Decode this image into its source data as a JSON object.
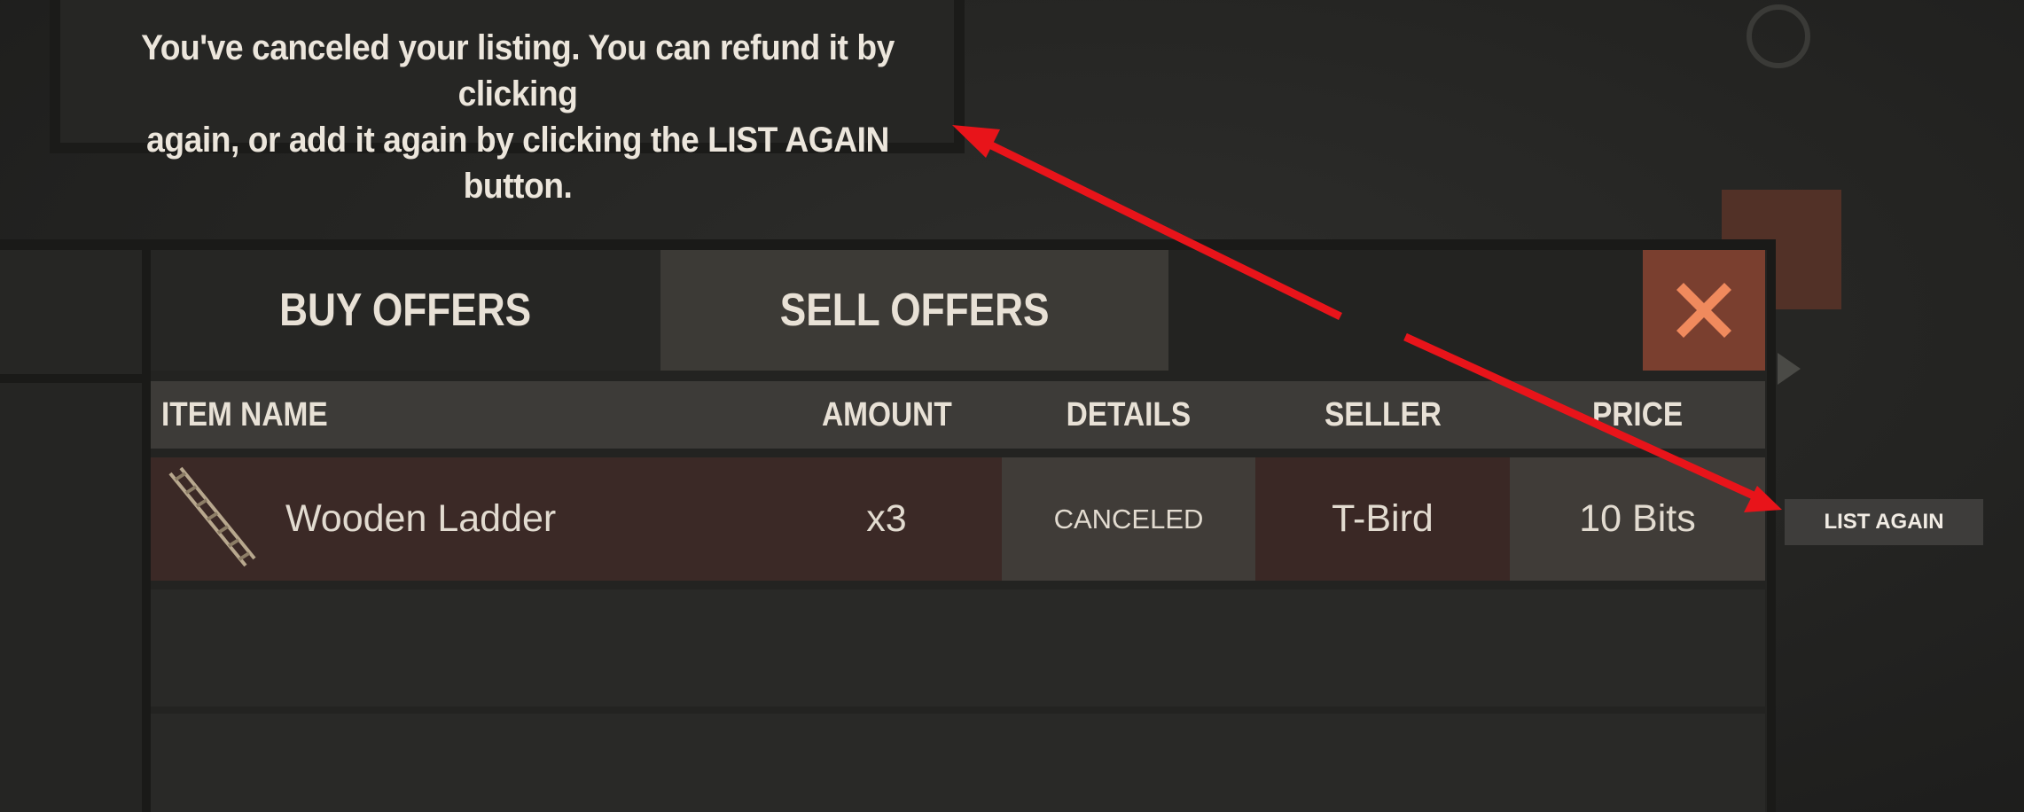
{
  "tooltip": {
    "line1": "You've canceled your listing. You can refund it by clicking",
    "line2": "again, or add it again by clicking the LIST AGAIN button."
  },
  "tabs": {
    "buy": "BUY OFFERS",
    "sell": "SELL OFFERS"
  },
  "columns": {
    "item_name": "ITEM NAME",
    "amount": "AMOUNT",
    "details": "DETAILS",
    "seller": "SELLER",
    "price": "PRICE"
  },
  "listing": {
    "icon": "wooden-ladder-icon",
    "item_name": "Wooden Ladder",
    "amount": "x3",
    "details": "CANCELED",
    "seller": "T-Bird",
    "price": "10 Bits"
  },
  "actions": {
    "list_again": "LIST AGAIN",
    "close_icon": "close-icon"
  },
  "colors": {
    "accent_close": "#7a3f2f",
    "close_glyph": "#f08a5d",
    "row_highlight": "#3b2926",
    "annotation_arrow": "#e8141a"
  }
}
